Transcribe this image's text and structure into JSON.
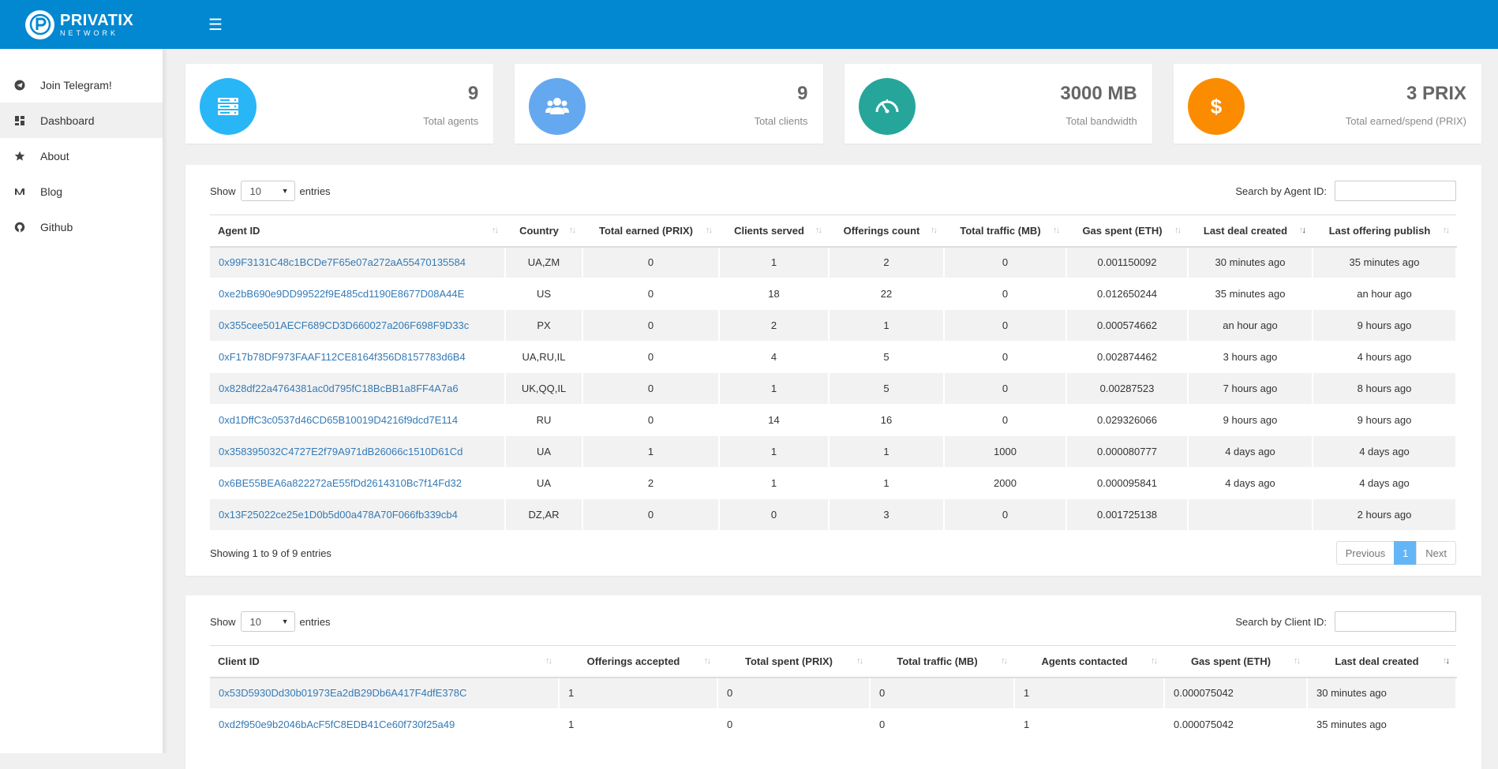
{
  "brand": {
    "title": "PRIVATIX",
    "subtitle": "NETWORK"
  },
  "colors": {
    "topbar": "#0288d1",
    "agents": "#29b6f6",
    "clients": "#64a8f0",
    "bandwidth": "#26a69a",
    "earned": "#fb8c00",
    "link": "#337ab7"
  },
  "sidebar": {
    "items": [
      {
        "label": "Join Telegram!",
        "icon": "telegram-icon"
      },
      {
        "label": "Dashboard",
        "icon": "dashboard-icon"
      },
      {
        "label": "About",
        "icon": "star-icon"
      },
      {
        "label": "Blog",
        "icon": "medium-icon"
      },
      {
        "label": "Github",
        "icon": "github-icon"
      }
    ]
  },
  "stats": [
    {
      "value": "9",
      "label": "Total agents",
      "icon": "server-icon"
    },
    {
      "value": "9",
      "label": "Total clients",
      "icon": "users-icon"
    },
    {
      "value": "3000 MB",
      "label": "Total bandwidth",
      "icon": "gauge-icon"
    },
    {
      "value": "3 PRIX",
      "label": "Total earned/spend (PRIX)",
      "icon": "dollar-icon"
    }
  ],
  "agents_table": {
    "show_label": "Show",
    "entries_label": "entries",
    "page_length": "10",
    "search_label": "Search by Agent ID:",
    "columns": [
      "Agent ID",
      "Country",
      "Total earned (PRIX)",
      "Clients served",
      "Offerings count",
      "Total traffic (MB)",
      "Gas spent (ETH)",
      "Last deal created",
      "Last offering publish"
    ],
    "rows": [
      [
        "0x99F3131C48c1BCDe7F65e07a272aA55470135584",
        "UA,ZM",
        "0",
        "1",
        "2",
        "0",
        "0.001150092",
        "30 minutes ago",
        "35 minutes ago"
      ],
      [
        "0xe2bB690e9DD99522f9E485cd1190E8677D08A44E",
        "US",
        "0",
        "18",
        "22",
        "0",
        "0.012650244",
        "35 minutes ago",
        "an hour ago"
      ],
      [
        "0x355cee501AECF689CD3D660027a206F698F9D33c",
        "PX",
        "0",
        "2",
        "1",
        "0",
        "0.000574662",
        "an hour ago",
        "9 hours ago"
      ],
      [
        "0xF17b78DF973FAAF112CE8164f356D8157783d6B4",
        "UA,RU,IL",
        "0",
        "4",
        "5",
        "0",
        "0.002874462",
        "3 hours ago",
        "4 hours ago"
      ],
      [
        "0x828df22a4764381ac0d795fC18BcBB1a8FF4A7a6",
        "UK,QQ,IL",
        "0",
        "1",
        "5",
        "0",
        "0.00287523",
        "7 hours ago",
        "8 hours ago"
      ],
      [
        "0xd1DffC3c0537d46CD65B10019D4216f9dcd7E114",
        "RU",
        "0",
        "14",
        "16",
        "0",
        "0.029326066",
        "9 hours ago",
        "9 hours ago"
      ],
      [
        "0x358395032C4727E2f79A971dB26066c1510D61Cd",
        "UA",
        "1",
        "1",
        "1",
        "1000",
        "0.000080777",
        "4 days ago",
        "4 days ago"
      ],
      [
        "0x6BE55BEA6a822272aE55fDd2614310Bc7f14Fd32",
        "UA",
        "2",
        "1",
        "1",
        "2000",
        "0.000095841",
        "4 days ago",
        "4 days ago"
      ],
      [
        "0x13F25022ce25e1D0b5d00a478A70F066fb339cb4",
        "DZ,AR",
        "0",
        "0",
        "3",
        "0",
        "0.001725138",
        "",
        "2 hours ago"
      ]
    ],
    "info": "Showing 1 to 9 of 9 entries",
    "pager": {
      "prev": "Previous",
      "current": "1",
      "next": "Next"
    }
  },
  "clients_table": {
    "show_label": "Show",
    "entries_label": "entries",
    "page_length": "10",
    "search_label": "Search by Client ID:",
    "columns": [
      "Client ID",
      "Offerings accepted",
      "Total spent (PRIX)",
      "Total traffic (MB)",
      "Agents contacted",
      "Gas spent (ETH)",
      "Last deal created"
    ],
    "rows": [
      [
        "0x53D5930Dd30b01973Ea2dB29Db6A417F4dfE378C",
        "1",
        "0",
        "0",
        "1",
        "0.000075042",
        "30 minutes ago"
      ],
      [
        "0xd2f950e9b2046bAcF5fC8EDB41Ce60f730f25a49",
        "1",
        "0",
        "0",
        "1",
        "0.000075042",
        "35 minutes ago"
      ]
    ]
  }
}
